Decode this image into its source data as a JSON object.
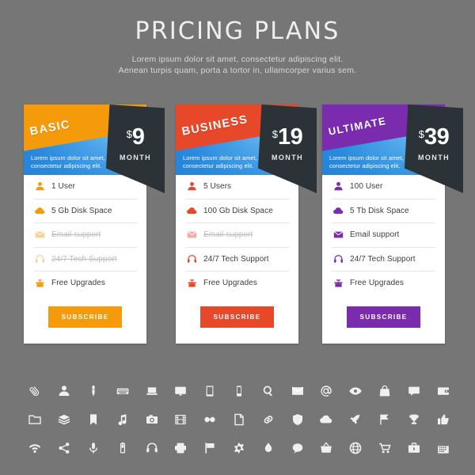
{
  "header": {
    "title": "PRICING PLANS",
    "subtitle_line1": "Lorem ipsum dolor sit amet, consectetur  adipiscing elit.",
    "subtitle_line2": "Aenean turpis quam, porta  a tortor in, ullamcorper varius sem."
  },
  "colors": {
    "page_background": "#767676",
    "basic": "#f59b0b",
    "business": "#e8482a",
    "ultimate": "#7b2bae",
    "ribbon": "#2b3338",
    "blue_band": "#2a8ade",
    "disabled_text": "#bdbdbd",
    "card_background": "#ffffff"
  },
  "plans": [
    {
      "name": "BASIC",
      "accent": "#f59b0b",
      "currency": "$",
      "price": "9",
      "period": "MONTH",
      "description_line1": "Lorem ipsum dolor sit amet,",
      "description_line2": "consectetur adipiscing elit.",
      "button_label": "SUBSCRIBE",
      "features": [
        {
          "icon": "user-icon",
          "label": "1 User",
          "enabled": true
        },
        {
          "icon": "cloud-icon",
          "label": "5 Gb Disk Space",
          "enabled": true
        },
        {
          "icon": "envelope-icon",
          "label": "Email support",
          "enabled": false
        },
        {
          "icon": "headphones-icon",
          "label": "24/7 Tech Support",
          "enabled": false
        },
        {
          "icon": "gift-icon",
          "label": "Free Upgrades",
          "enabled": true
        }
      ]
    },
    {
      "name": "BUSINESS",
      "accent": "#e8482a",
      "currency": "$",
      "price": "19",
      "period": "MONTH",
      "description_line1": "Lorem ipsum dolor sit amet,",
      "description_line2": "consectetur adipiscing elit.",
      "button_label": "SUBSCRIBE",
      "features": [
        {
          "icon": "user-icon",
          "label": "5 Users",
          "enabled": true
        },
        {
          "icon": "cloud-icon",
          "label": "100 Gb Disk Space",
          "enabled": true
        },
        {
          "icon": "envelope-icon",
          "label": "Email support",
          "enabled": false
        },
        {
          "icon": "headphones-icon",
          "label": "24/7 Tech Support",
          "enabled": true
        },
        {
          "icon": "gift-icon",
          "label": "Free Upgrades",
          "enabled": true
        }
      ]
    },
    {
      "name": "ULTIMATE",
      "accent": "#7b2bae",
      "currency": "$",
      "price": "39",
      "period": "MONTH",
      "description_line1": "Lorem ipsum dolor sit amet,",
      "description_line2": "consectetur adipiscing elit.",
      "button_label": "SUBSCRIBE",
      "features": [
        {
          "icon": "user-icon",
          "label": "100 User",
          "enabled": true
        },
        {
          "icon": "cloud-icon",
          "label": "5 Tb Disk Space",
          "enabled": true
        },
        {
          "icon": "envelope-icon",
          "label": "Email support",
          "enabled": true
        },
        {
          "icon": "headphones-icon",
          "label": "24/7 Tech Support",
          "enabled": true
        },
        {
          "icon": "gift-icon",
          "label": "Free Upgrades",
          "enabled": true
        }
      ]
    }
  ],
  "icon_grid": {
    "color": "#f0f0f0",
    "rows": [
      [
        "paperclip-icon",
        "user-icon",
        "pen-icon",
        "keyboard-icon",
        "laptop-icon",
        "monitor-icon",
        "tablet-icon",
        "smartphone-icon",
        "search-icon",
        "envelope-icon",
        "at-sign-icon",
        "eye-icon",
        "bag-icon",
        "chat-icon",
        "wallet-icon"
      ],
      [
        "folder-icon",
        "layers-icon",
        "bookmark-icon",
        "music-note-icon",
        "camera-icon",
        "film-icon",
        "glasses-icon",
        "document-icon",
        "link-icon",
        "shield-icon",
        "cloud-icon",
        "rocket-icon",
        "flag-pennant-icon",
        "trophy-icon",
        "thumbs-up-icon"
      ],
      [
        "wifi-icon",
        "share-icon",
        "microphone-icon",
        "battery-icon",
        "headphones-icon",
        "printer-icon",
        "flag-icon",
        "gear-icon",
        "droplet-icon",
        "speech-bubble-icon",
        "basket-icon",
        "globe-icon",
        "shopping-cart-icon",
        "briefcase-icon",
        "calendar-icon"
      ]
    ]
  }
}
